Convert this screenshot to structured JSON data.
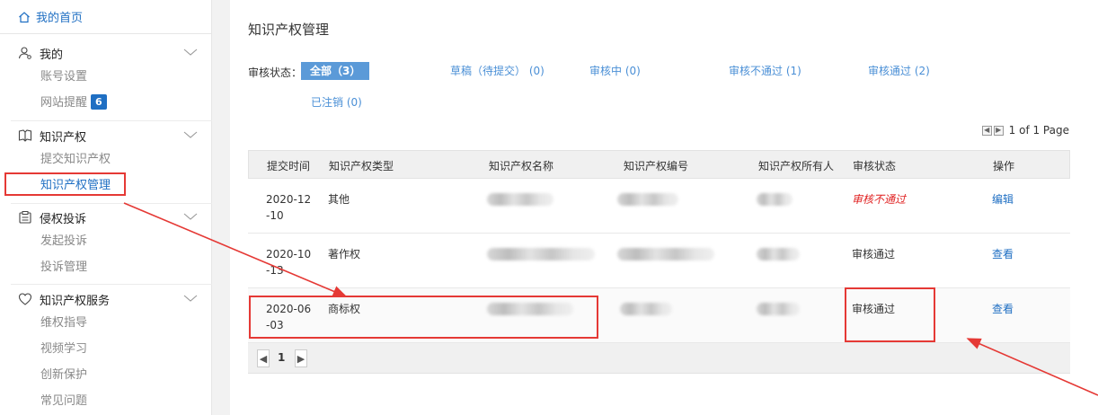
{
  "sidebar": {
    "home": "我的首页",
    "sections": [
      {
        "title": "我的",
        "items": [
          {
            "label": "账号设置"
          },
          {
            "label": "网站提醒",
            "badge": "6"
          }
        ]
      },
      {
        "title": "知识产权",
        "items": [
          {
            "label": "提交知识产权"
          },
          {
            "label": "知识产权管理",
            "active": true
          }
        ]
      },
      {
        "title": "侵权投诉",
        "items": [
          {
            "label": "发起投诉"
          },
          {
            "label": "投诉管理"
          }
        ]
      },
      {
        "title": "知识产权服务",
        "items": [
          {
            "label": "维权指导"
          },
          {
            "label": "视频学习"
          },
          {
            "label": "创新保护"
          },
          {
            "label": "常见问题"
          }
        ]
      }
    ]
  },
  "main": {
    "title": "知识产权管理",
    "filter_label": "审核状态：",
    "filters": [
      {
        "label": "全部（3）",
        "active": true
      },
      {
        "label": "草稿（待提交）  (0)"
      },
      {
        "label": "审核中  (0)"
      },
      {
        "label": "审核不通过  (1)"
      },
      {
        "label": "审核通过  (2)"
      },
      {
        "label": "已注销  (0)"
      }
    ],
    "pagination_top": "1 of 1 Page",
    "table": {
      "columns": [
        "提交时间",
        "知识产权类型",
        "知识产权名称",
        "知识产权编号",
        "知识产权所有人",
        "审核状态",
        "操作"
      ],
      "rows": [
        {
          "date": "2020-12-10",
          "type": "其他",
          "status": "审核不通过",
          "action": "编辑"
        },
        {
          "date": "2020-10-13",
          "type": "著作权",
          "status": "审核通过",
          "action": "查看"
        },
        {
          "date": "2020-06-03",
          "type": "商标权",
          "status": "审核通过",
          "action": "查看"
        }
      ]
    },
    "pagination_bottom": {
      "page": "1"
    }
  },
  "colors": {
    "accent": "#1f6fc3",
    "filter_active_bg": "#5b9ad8",
    "fail": "#e02020",
    "annotation": "#e53935"
  },
  "icons": [
    "home-icon",
    "user-icon",
    "book-icon",
    "clipboard-icon",
    "heart-icon",
    "chevron-down-icon",
    "prev-page-icon",
    "next-page-icon"
  ]
}
